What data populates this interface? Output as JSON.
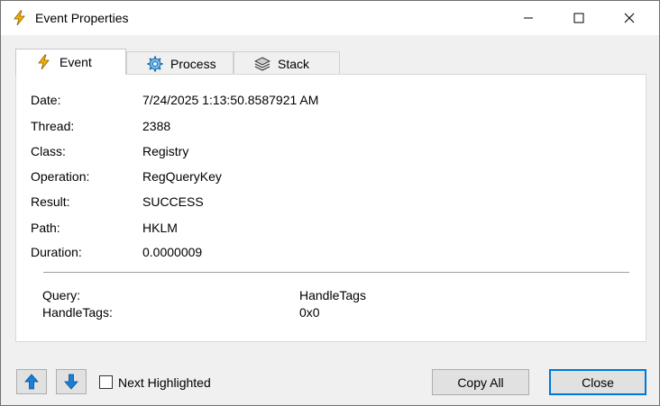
{
  "window": {
    "title": "Event Properties",
    "icon": "lightning-icon"
  },
  "tabs": [
    {
      "label": "Event",
      "icon": "lightning-icon",
      "active": true
    },
    {
      "label": "Process",
      "icon": "gear-icon",
      "active": false
    },
    {
      "label": "Stack",
      "icon": "layers-icon",
      "active": false
    }
  ],
  "properties": [
    {
      "label": "Date:",
      "value": "7/24/2025 1:13:50.8587921 AM"
    },
    {
      "label": "Thread:",
      "value": "2388"
    },
    {
      "label": "Class:",
      "value": "Registry"
    },
    {
      "label": "Operation:",
      "value": "RegQueryKey"
    },
    {
      "label": "Result:",
      "value": "SUCCESS"
    },
    {
      "label": "Path:",
      "value": "HKLM"
    },
    {
      "label": "Duration:",
      "value": "0.0000009"
    }
  ],
  "details": [
    {
      "label": "Query:",
      "value": "HandleTags"
    },
    {
      "label": "HandleTags:",
      "value": "0x0"
    }
  ],
  "footer": {
    "prev_icon": "arrow-up-icon",
    "next_icon": "arrow-down-icon",
    "checkbox_label": "Next Highlighted",
    "checkbox_checked": false,
    "copy_all_label": "Copy All",
    "close_label": "Close"
  },
  "colors": {
    "accent": "#0078d7",
    "arrow": "#1a7fd6",
    "lightning": "#f2b600"
  }
}
